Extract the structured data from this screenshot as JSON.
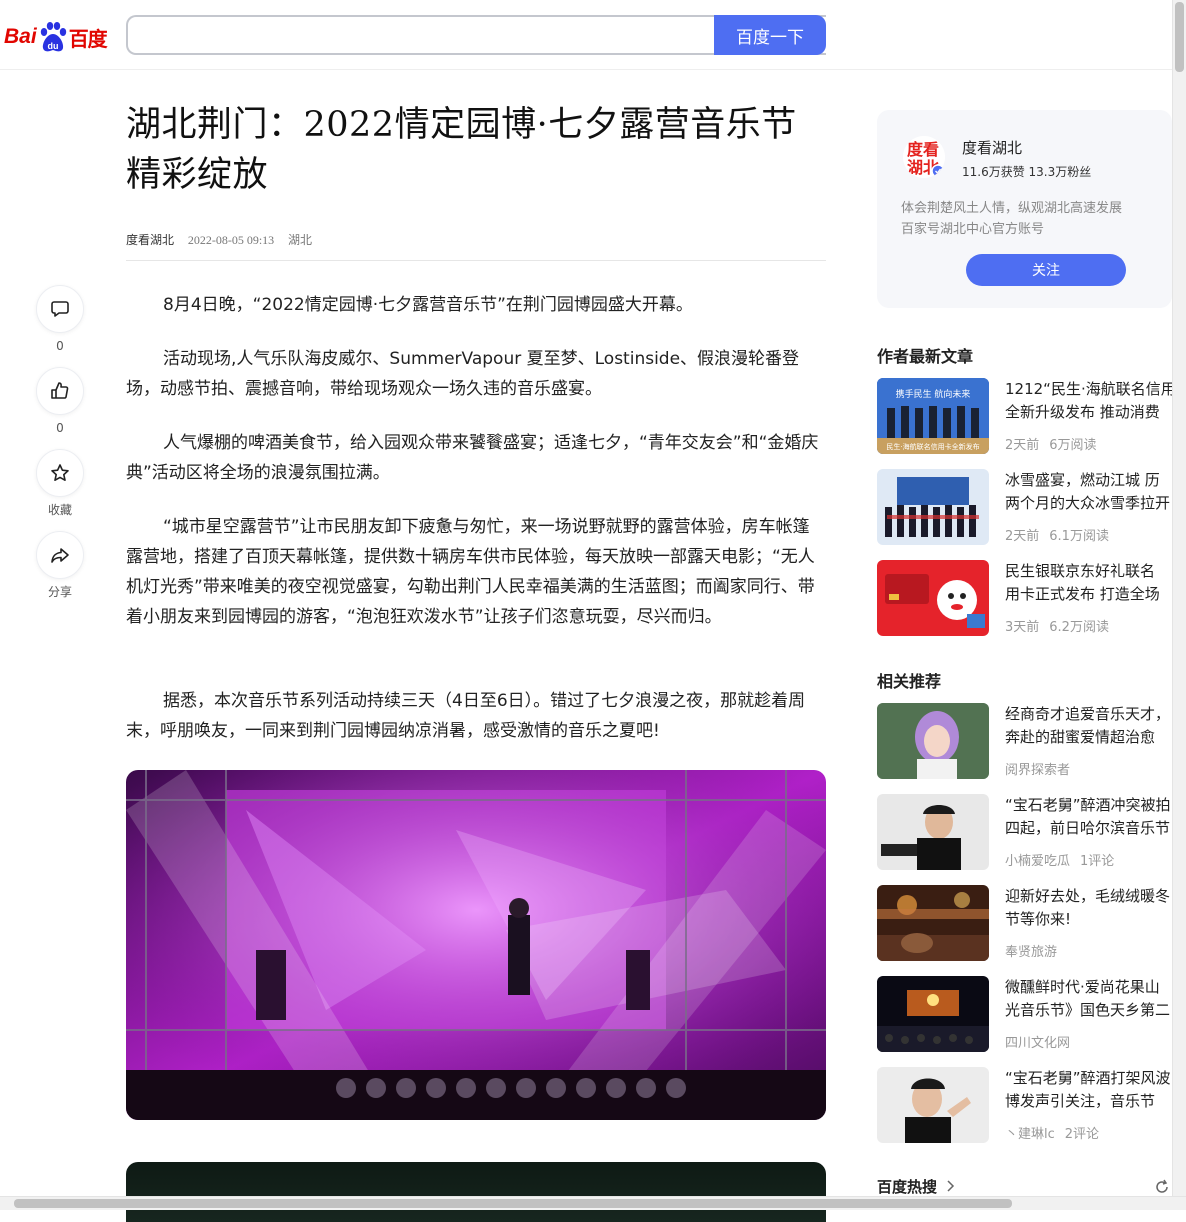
{
  "header": {
    "logo_text_left": "Bai",
    "logo_text_right": "百度",
    "search_value": "",
    "search_button": "百度一下"
  },
  "rail": {
    "comment_count": "0",
    "like_count": "0",
    "favorite_label": "收藏",
    "share_label": "分享"
  },
  "article": {
    "title": "湖北荆门：2022情定园博·七夕露营音乐节精彩绽放",
    "author": "度看湖北",
    "time": "2022-08-05 09:13",
    "location": "湖北",
    "paragraphs": [
      "8月4日晚，“2022情定园博·七夕露营音乐节”在荆门园博园盛大开幕。",
      "活动现场,人气乐队海皮威尔、SummerVapour 夏至梦、Lostinside、假浪漫轮番登场，动感节拍、震撼音响，带给现场观众一场久违的音乐盛宴。",
      "人气爆棚的啤酒美食节，给入园观众带来饕餮盛宴；适逢七夕，“青年交友会”和“金婚庆典”活动区将全场的浪漫氛围拉满。",
      "“城市星空露营节”让市民朋友卸下疲惫与匆忙，来一场说野就野的露营体验，房车帐篷露营地，搭建了百顶天幕帐篷，提供数十辆房车供市民体验，每天放映一部露天电影；“无人机灯光秀”带来唯美的夜空视觉盛宴，勾勒出荆门人民幸福美满的生活蓝图；而阖家同行、带着小朋友来到园博园的游客，“泡泡狂欢泼水节”让孩子们恣意玩耍，尽兴而归。",
      "据悉，本次音乐节系列活动持续三天（4日至6日）。错过了七夕浪漫之夜，那就趁着周末，呼朋唤友，一同来到荆门园博园纳凉消暑，感受激情的音乐之夏吧!"
    ]
  },
  "author_card": {
    "name": "度看湖北",
    "stats": "11.6万获赞 13.3万粉丝",
    "desc_line1": "体会荆楚风土人情，纵观湖北高速发展",
    "desc_line2": "百家号湖北中心官方账号",
    "follow_button": "关注",
    "avatar_text_top": "度看",
    "avatar_text_bottom": "湖北"
  },
  "latest": {
    "title": "作者最新文章",
    "items": [
      {
        "line1": "1212“民生·海航联名信用",
        "line2": "全新升级发布 推动消费",
        "time": "2天前",
        "reads": "6万阅读",
        "thumb_caption": "民生·海航联名信用卡全新发布",
        "thumb_banner": "携手民生 航向未来"
      },
      {
        "line1": "冰雪盛宴，燃动江城 历",
        "line2": "两个月的大众冰雪季拉开",
        "time": "2天前",
        "reads": "6.1万阅读"
      },
      {
        "line1": "民生银联京东好礼联名",
        "line2": "用卡正式发布 打造全场",
        "time": "3天前",
        "reads": "6.2万阅读"
      }
    ]
  },
  "related": {
    "title": "相关推荐",
    "items": [
      {
        "line1": "经商奇才追爱音乐天才，",
        "line2": "奔赴的甜蜜爱情超治愈",
        "source": "阅界探索者",
        "extra": ""
      },
      {
        "line1": "“宝石老舅”醉酒冲突被拍",
        "line2": "四起，前日哈尔滨音乐节",
        "source": "小楠爱吃瓜",
        "extra": "1评论"
      },
      {
        "line1": "迎新好去处，毛绒绒暖冬",
        "line2": "节等你来!",
        "source": "奉贤旅游",
        "extra": ""
      },
      {
        "line1": "微醺鲜时代·爱尚花果山",
        "line2": "光音乐节》国色天乡第二",
        "source": "四川文化网",
        "extra": ""
      },
      {
        "line1": "“宝石老舅”醉酒打架风波",
        "line2": "博发声引关注，音乐节",
        "source": "丶建琳lc",
        "extra": "2评论"
      }
    ]
  },
  "hot_search": "百度热搜",
  "colors": {
    "brand_blue": "#4e6ef2",
    "brand_red": "#e10601"
  }
}
